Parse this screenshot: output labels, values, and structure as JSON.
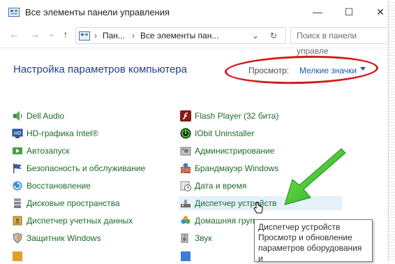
{
  "window": {
    "title": "Все элементы панели управления",
    "minimize_glyph": "—",
    "maximize_glyph": "☐",
    "close_glyph": "✕"
  },
  "nav": {
    "back_glyph": "←",
    "forward_glyph": "→",
    "recent_glyph": "⌄",
    "up_glyph": "↑",
    "breadcrumb": [
      "Пан...",
      "Все элементы пан..."
    ],
    "breadcrumb_sep": "›",
    "dropdown_glyph": "⌄",
    "refresh_glyph": "↻",
    "search_placeholder": "Поиск в панели управле"
  },
  "header": {
    "title": "Настройка параметров компьютера",
    "view_by_label": "Просмотр:",
    "view_by_value": "Мелкие значки"
  },
  "items_left": [
    {
      "label": "Dell Audio",
      "icon": "audio-icon"
    },
    {
      "label": "HD-графика Intel®",
      "icon": "intel-graphics-icon"
    },
    {
      "label": "Автозапуск",
      "icon": "autoplay-icon"
    },
    {
      "label": "Безопасность и обслуживание",
      "icon": "flag-icon"
    },
    {
      "label": "Восстановление",
      "icon": "recovery-icon"
    },
    {
      "label": "Дисковые пространства",
      "icon": "storage-spaces-icon"
    },
    {
      "label": "Диспетчер учетных данных",
      "icon": "credential-manager-icon"
    },
    {
      "label": "Защитник Windows",
      "icon": "defender-icon"
    }
  ],
  "items_right": [
    {
      "label": "Flash Player (32 бита)",
      "icon": "flash-icon"
    },
    {
      "label": "IObit Uninstaller",
      "icon": "iobit-icon"
    },
    {
      "label": "Администрирование",
      "icon": "admin-tools-icon"
    },
    {
      "label": "Брандмауэр Windows",
      "icon": "firewall-icon"
    },
    {
      "label": "Дата и время",
      "icon": "clock-icon"
    },
    {
      "label": "Диспетчер устройств",
      "icon": "device-manager-icon"
    },
    {
      "label": "Домашняя груп",
      "icon": "homegroup-icon"
    },
    {
      "label": "Звук",
      "icon": "sound-icon"
    }
  ],
  "tooltip": {
    "line1": "Диспетчер устройств",
    "line2": "Просмотр и обновление",
    "line3": "параметров оборудования и"
  },
  "colors": {
    "link_green": "#1e6b29",
    "heading_blue": "#1f3f8c",
    "annotation_red": "#d31b1b",
    "annotation_green": "#2ecc1b"
  }
}
